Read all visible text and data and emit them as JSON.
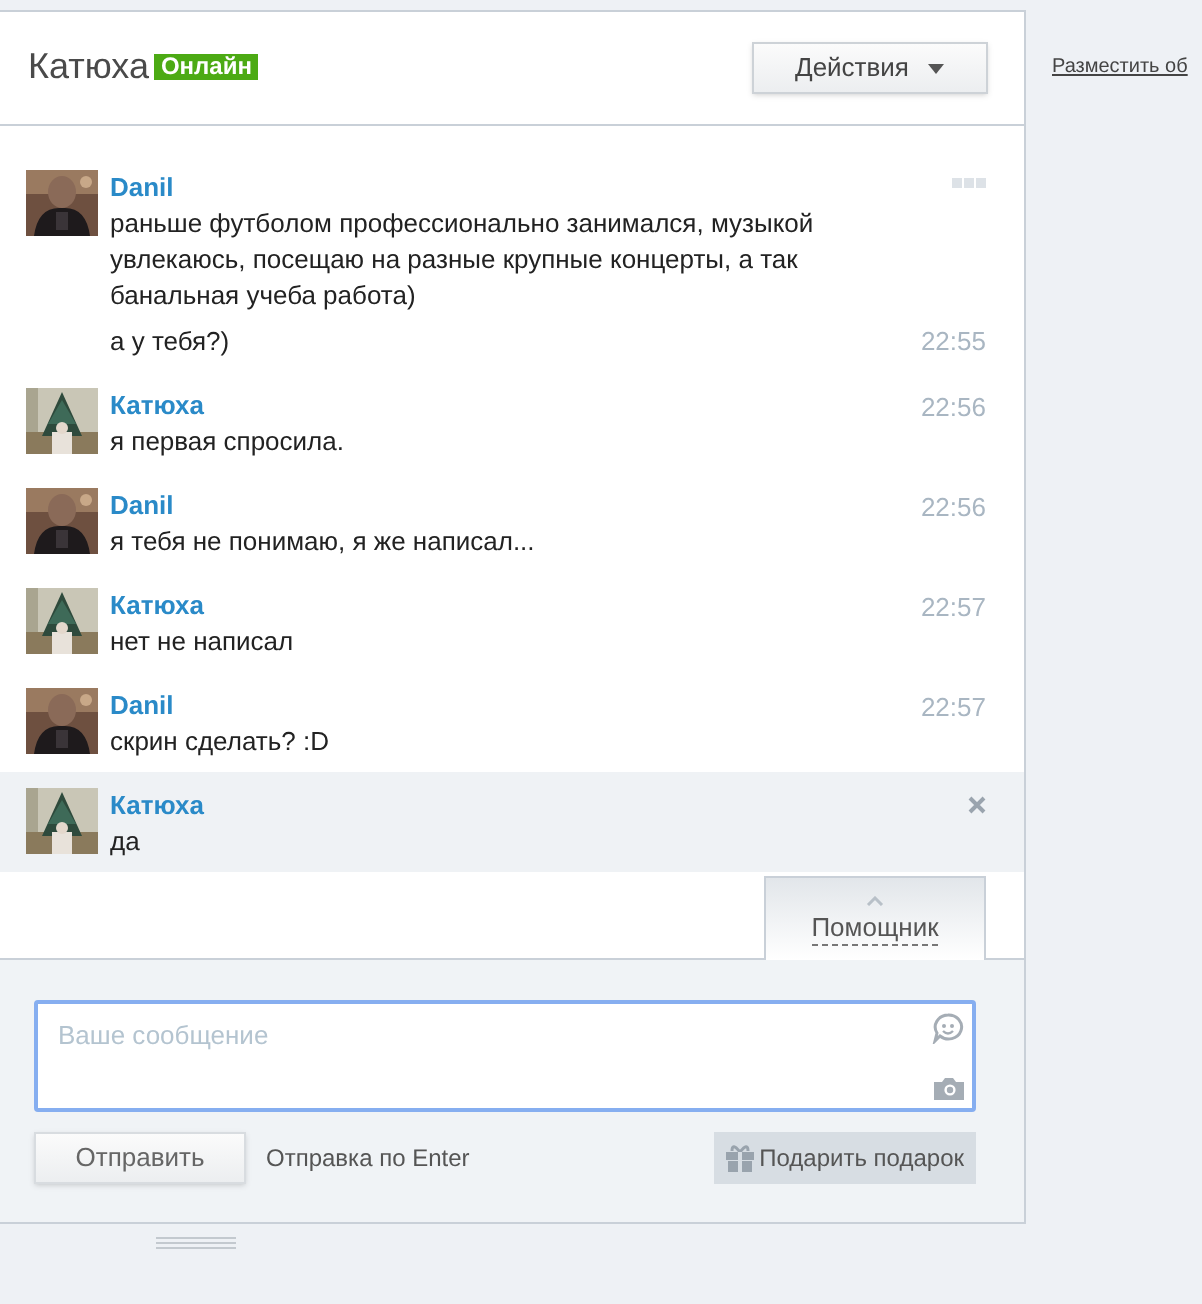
{
  "header": {
    "contact_name": "Катюха",
    "status": "Онлайн",
    "online": true,
    "actions_button": "Действия"
  },
  "side_link": "Разместить об",
  "messages": [
    {
      "author": "Danil",
      "highlighted": false,
      "kind": "menu",
      "paragraphs": [
        {
          "text": "раньше футболом профессионально занимался, музыкой увлекаюсь, посещаю на разные крупные концерты, а так банальная учеба работа)"
        },
        {
          "text": "а у тебя?)",
          "time": "22:55"
        }
      ]
    },
    {
      "author": "Катюха",
      "highlighted": false,
      "kind": "time",
      "time": "22:56",
      "paragraphs": [
        {
          "text": "я первая спросила."
        }
      ]
    },
    {
      "author": "Danil",
      "highlighted": false,
      "kind": "time",
      "time": "22:56",
      "paragraphs": [
        {
          "text": "я тебя не понимаю, я же написал..."
        }
      ]
    },
    {
      "author": "Катюха",
      "highlighted": false,
      "kind": "time",
      "time": "22:57",
      "paragraphs": [
        {
          "text": "нет не написал"
        }
      ]
    },
    {
      "author": "Danil",
      "highlighted": false,
      "kind": "time",
      "time": "22:57",
      "paragraphs": [
        {
          "text": "скрин сделать? :D"
        }
      ]
    },
    {
      "author": "Катюха",
      "highlighted": true,
      "kind": "close",
      "paragraphs": [
        {
          "text": "да"
        }
      ]
    }
  ],
  "helper_tab": {
    "label": "Помощник",
    "selected": false
  },
  "composer": {
    "placeholder": "Ваше сообщение",
    "send_button": "Отправить",
    "send_hint": "Отправка по Enter",
    "gift_button": "Подарить подарок"
  }
}
